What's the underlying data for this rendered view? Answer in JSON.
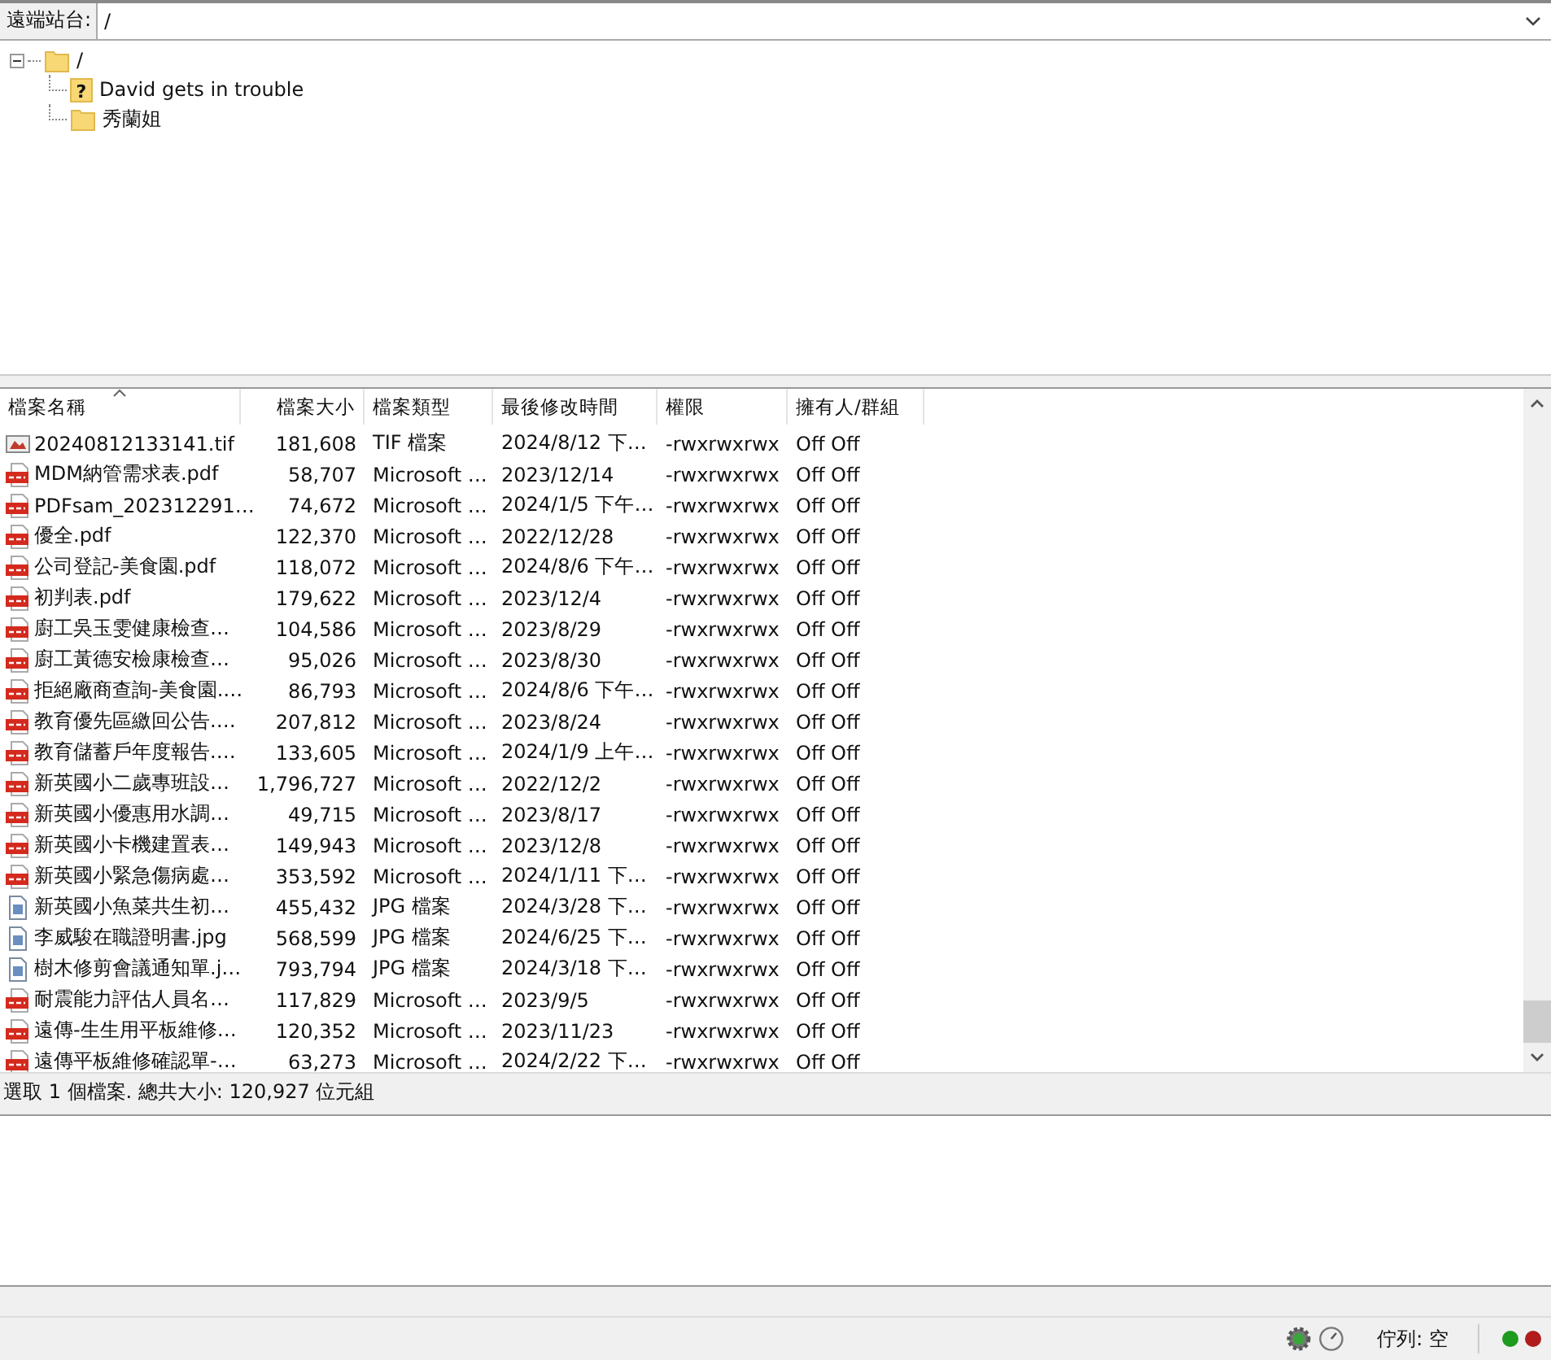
{
  "remote_site": {
    "label": "遠端站台:",
    "value": "/"
  },
  "tree": [
    {
      "name": "/",
      "kind": "folder",
      "expanded": true,
      "children": [
        {
          "name": "David gets in trouble",
          "kind": "unknown",
          "badge": "?"
        },
        {
          "name": "秀蘭姐",
          "kind": "folder"
        }
      ]
    }
  ],
  "table": {
    "columns": [
      {
        "label": "檔案名稱",
        "sorted": true
      },
      {
        "label": "檔案大小",
        "sorted": false
      },
      {
        "label": "檔案類型",
        "sorted": false
      },
      {
        "label": "最後修改時間",
        "sorted": false
      },
      {
        "label": "權限",
        "sorted": false
      },
      {
        "label": "擁有人/群組",
        "sorted": false
      }
    ],
    "rows": [
      {
        "kind": "tif",
        "cells": [
          "20240812133141.tif",
          "181,608",
          "TIF 檔案",
          "2024/8/12 下…",
          "-rwxrwxrwx",
          "Off Off"
        ]
      },
      {
        "kind": "pdf",
        "cells": [
          "MDM納管需求表.pdf",
          "58,707",
          "Microsoft …",
          "2023/12/14",
          "-rwxrwxrwx",
          "Off Off"
        ]
      },
      {
        "kind": "pdf",
        "cells": [
          "PDFsam_202312291…",
          "74,672",
          "Microsoft …",
          "2024/1/5 下午…",
          "-rwxrwxrwx",
          "Off Off"
        ]
      },
      {
        "kind": "pdf",
        "cells": [
          "優全.pdf",
          "122,370",
          "Microsoft …",
          "2022/12/28",
          "-rwxrwxrwx",
          "Off Off"
        ]
      },
      {
        "kind": "pdf",
        "cells": [
          "公司登記-美食園.pdf",
          "118,072",
          "Microsoft …",
          "2024/8/6 下午…",
          "-rwxrwxrwx",
          "Off Off"
        ]
      },
      {
        "kind": "pdf",
        "cells": [
          "初判表.pdf",
          "179,622",
          "Microsoft …",
          "2023/12/4",
          "-rwxrwxrwx",
          "Off Off"
        ]
      },
      {
        "kind": "pdf",
        "cells": [
          "廚工吳玉雯健康檢查…",
          "104,586",
          "Microsoft …",
          "2023/8/29",
          "-rwxrwxrwx",
          "Off Off"
        ]
      },
      {
        "kind": "pdf",
        "cells": [
          "廚工黃德安檢康檢查…",
          "95,026",
          "Microsoft …",
          "2023/8/30",
          "-rwxrwxrwx",
          "Off Off"
        ]
      },
      {
        "kind": "pdf",
        "cells": [
          "拒絕廠商查詢-美食園.…",
          "86,793",
          "Microsoft …",
          "2024/8/6 下午…",
          "-rwxrwxrwx",
          "Off Off"
        ]
      },
      {
        "kind": "pdf",
        "cells": [
          "教育優先區繳回公告.…",
          "207,812",
          "Microsoft …",
          "2023/8/24",
          "-rwxrwxrwx",
          "Off Off"
        ]
      },
      {
        "kind": "pdf",
        "cells": [
          "教育儲蓄戶年度報告.…",
          "133,605",
          "Microsoft …",
          "2024/1/9 上午…",
          "-rwxrwxrwx",
          "Off Off"
        ]
      },
      {
        "kind": "pdf",
        "cells": [
          "新英國小二歲專班設…",
          "1,796,727",
          "Microsoft …",
          "2022/12/2",
          "-rwxrwxrwx",
          "Off Off"
        ]
      },
      {
        "kind": "pdf",
        "cells": [
          "新英國小優惠用水調…",
          "49,715",
          "Microsoft …",
          "2023/8/17",
          "-rwxrwxrwx",
          "Off Off"
        ]
      },
      {
        "kind": "pdf",
        "cells": [
          "新英國小卡機建置表…",
          "149,943",
          "Microsoft …",
          "2023/12/8",
          "-rwxrwxrwx",
          "Off Off"
        ]
      },
      {
        "kind": "pdf",
        "cells": [
          "新英國小緊急傷病處…",
          "353,592",
          "Microsoft …",
          "2024/1/11 下…",
          "-rwxrwxrwx",
          "Off Off"
        ]
      },
      {
        "kind": "jpg",
        "cells": [
          "新英國小魚菜共生初…",
          "455,432",
          "JPG 檔案",
          "2024/3/28 下…",
          "-rwxrwxrwx",
          "Off Off"
        ]
      },
      {
        "kind": "jpg",
        "cells": [
          "李威駿在職證明書.jpg",
          "568,599",
          "JPG 檔案",
          "2024/6/25 下…",
          "-rwxrwxrwx",
          "Off Off"
        ]
      },
      {
        "kind": "jpg",
        "cells": [
          "樹木修剪會議通知單.j…",
          "793,794",
          "JPG 檔案",
          "2024/3/18 下…",
          "-rwxrwxrwx",
          "Off Off"
        ]
      },
      {
        "kind": "pdf",
        "cells": [
          "耐震能力評估人員名…",
          "117,829",
          "Microsoft …",
          "2023/9/5",
          "-rwxrwxrwx",
          "Off Off"
        ]
      },
      {
        "kind": "pdf",
        "cells": [
          "遠傳-生生用平板維修…",
          "120,352",
          "Microsoft …",
          "2023/11/23",
          "-rwxrwxrwx",
          "Off Off"
        ]
      },
      {
        "kind": "pdf",
        "cells": [
          "遠傳平板維修確認單-…",
          "63,273",
          "Microsoft …",
          "2024/2/22 下…",
          "-rwxrwxrwx",
          "Off Off"
        ]
      }
    ]
  },
  "selection_status": "選取 1 個檔案. 總共大小: 120,927 位元組",
  "status_bar": {
    "queue": "佇列: 空",
    "lights": [
      {
        "color": "#1e9a1e"
      },
      {
        "color": "#b01c1c"
      }
    ]
  }
}
